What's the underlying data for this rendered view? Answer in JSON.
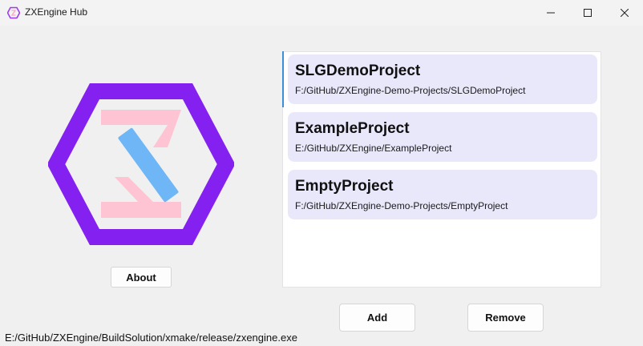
{
  "window": {
    "title": "ZXEngine Hub",
    "icon": "zxengine-logo-icon",
    "controls": [
      "minimize-icon",
      "maximize-icon",
      "close-icon"
    ]
  },
  "sidebar": {
    "logo": "zxengine-logo",
    "about_label": "About"
  },
  "projects": [
    {
      "name": "SLGDemoProject",
      "path": "F:/GitHub/ZXEngine-Demo-Projects/SLGDemoProject",
      "selected": true
    },
    {
      "name": "ExampleProject",
      "path": "E:/GitHub/ZXEngine/ExampleProject",
      "selected": false
    },
    {
      "name": "EmptyProject",
      "path": "F:/GitHub/ZXEngine-Demo-Projects/EmptyProject",
      "selected": false
    }
  ],
  "actions": {
    "add_label": "Add",
    "remove_label": "Remove"
  },
  "status": {
    "exe_path": "E:/GitHub/ZXEngine/BuildSolution/xmake/release/zxengine.exe"
  },
  "colors": {
    "hexagon": "#8421f0",
    "z_shape": "#ffc4d3",
    "diagonal": "#6fb6f6",
    "card_bg": "#e9e8fb",
    "selection_bar": "#3a8fd8"
  }
}
